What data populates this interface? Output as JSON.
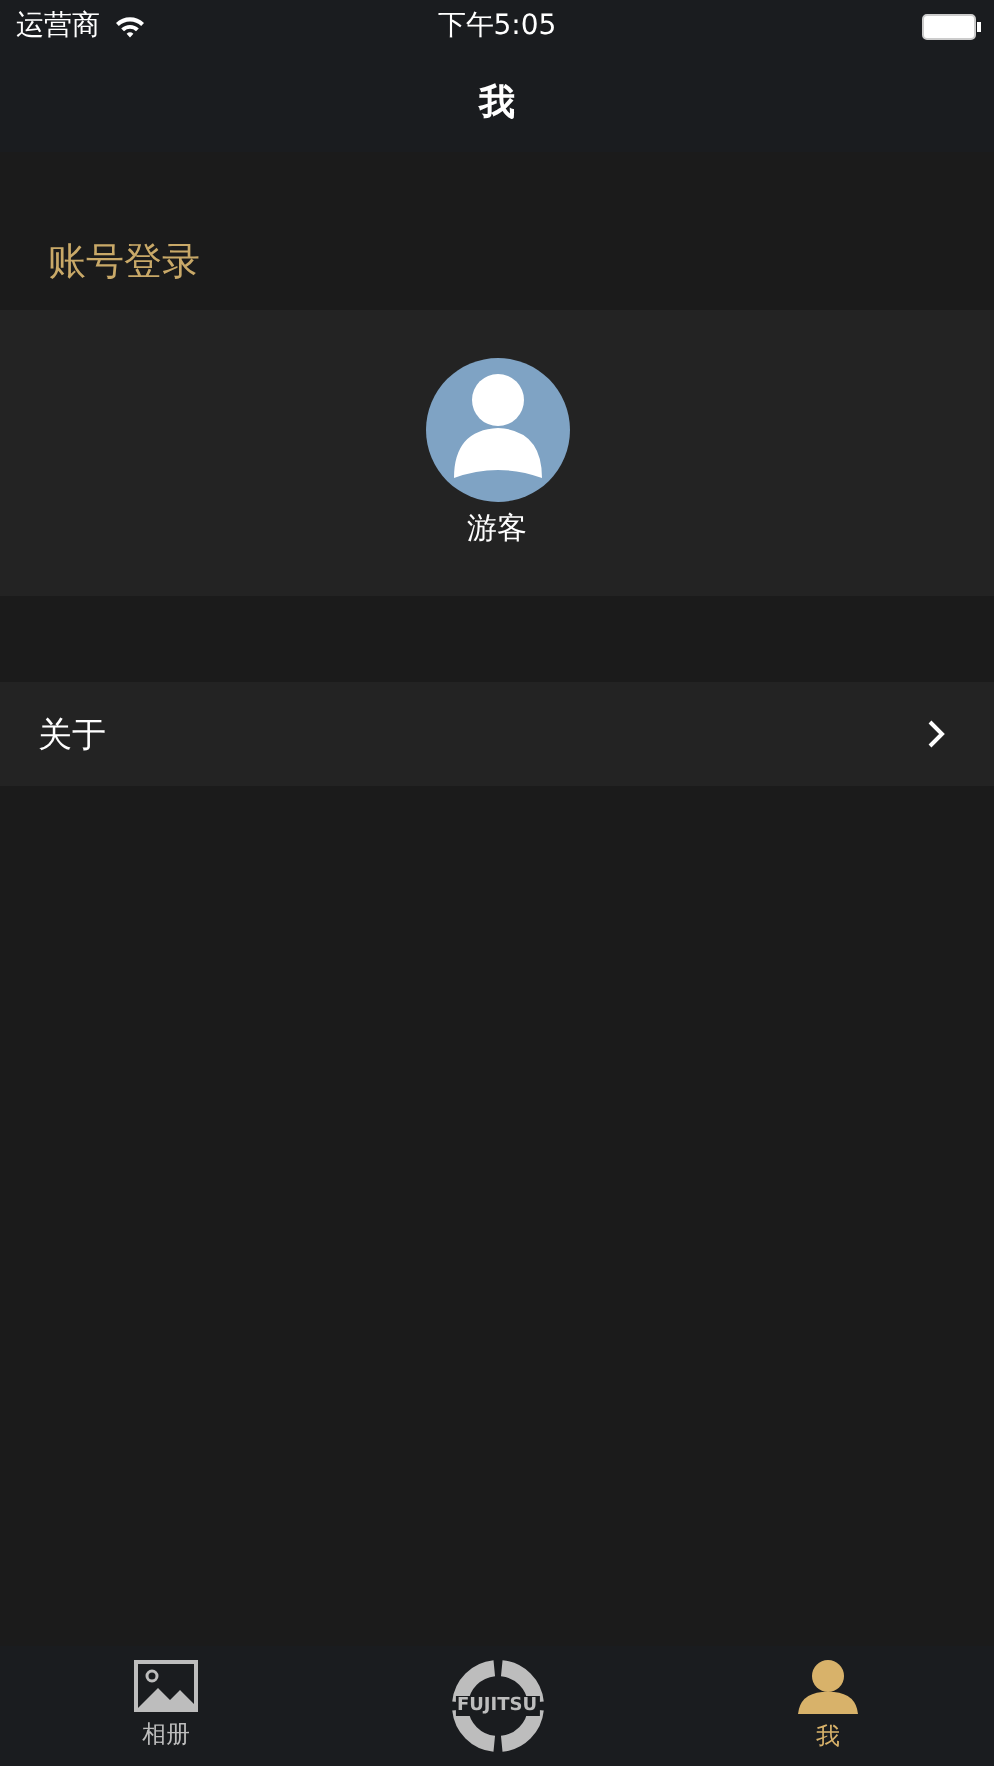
{
  "status_bar": {
    "carrier": "运营商",
    "time": "下午5:05"
  },
  "nav_bar": {
    "title": "我"
  },
  "account_section": {
    "header": "账号登录",
    "user_name": "游客"
  },
  "menu_items": [
    {
      "label": "关于"
    }
  ],
  "tab_bar": [
    {
      "kind": "photo",
      "label": "相册",
      "selected": false
    },
    {
      "kind": "logo",
      "label": "FUJITSU",
      "selected": false
    },
    {
      "kind": "person",
      "label": "我",
      "selected": true
    }
  ]
}
